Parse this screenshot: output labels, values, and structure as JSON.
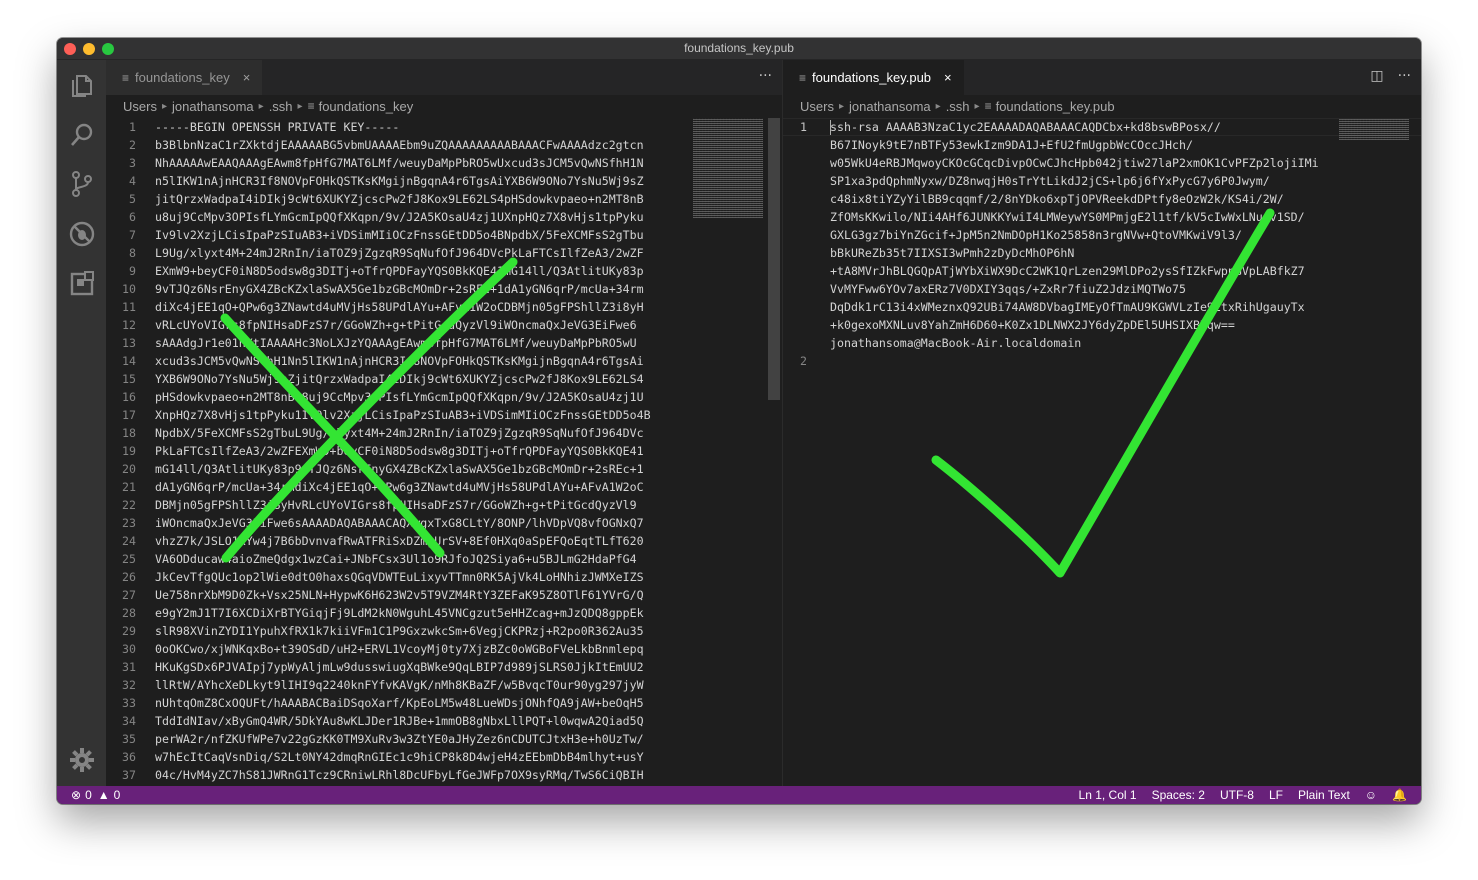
{
  "window": {
    "title": "foundations_key.pub"
  },
  "icons": {
    "explorer": "files-icon",
    "search": "search-icon",
    "scm": "source-control-icon",
    "debug": "debug-icon",
    "extensions": "extensions-icon",
    "settings": "gear-icon"
  },
  "left_editor": {
    "tab_label": "foundations_key",
    "tab_close": "×",
    "breadcrumb": [
      "Users",
      "jonathansoma",
      ".ssh",
      "foundations_key"
    ],
    "lines": [
      "-----BEGIN OPENSSH PRIVATE KEY-----",
      "b3BlbnNzaC1rZXktdjEAAAAABG5vbmUAAAAEbm9uZQAAAAAAAAABAAACFwAAAAdzc2gtcn",
      "NhAAAAAwEAAQAAAgEAwm8fpHfG7MAT6LMf/weuyDaMpPbRO5wUxcud3sJCM5vQwNSfhH1N",
      "n5lIKW1nAjnHCR3If8NOVpFOHkQSTKsKMgijnBgqnA4r6TgsAiYXB6W9ONo7YsNu5Wj9sZ",
      "jitQrzxWadpaI4iDIkj9cWt6XUKYZjcscPw2fJ8Kox9LE62LS4pHSdowkvpaeo+n2MT8nB",
      "u8uj9CcMpv3OPIsfLYmGcmIpQQfXKqpn/9v/J2A5KOsaU4zj1UXnpHQz7X8vHjs1tpPyku",
      "Iv9lv2XzjLCisIpaPzSIuAB3+iVDSimMIiOCzFnssGEtDD5o4BNpdbX/5FeXCMFsS2gTbu",
      "L9Ug/xlyxt4M+24mJ2RnIn/iaTOZ9jZgzqR9SqNufOfJ964DVcPkLaFTCsIlfZeA3/2wZF",
      "EXmW9+beyCF0iN8D5odsw8g3DITj+oTfrQPDFayYQS0BkKQE41mG14ll/Q3AtlitUKy83p",
      "9vTJQz6NsrEnyGX4ZBcKZxlaSwAX5Ge1bzGBcMOmDr+2sREc+1dA1yGN6qrP/mcUa+34rm",
      "diXc4jEE1qO+QPw6g3ZNawtd4uMVjHs58UPdlAYu+AFvA1W2oCDBMjn05gFPShllZ3i8yH",
      "vRLcUYoVIGrs8fpNIHsaDFzS7r/GGoWZh+g+tPitGcdQyzVl9iWOncmaQxJeVG3EiFwe6",
      "sAAAdgJr1e01hXtIAAAAHc3NoLXJzYQAAAgEAwm8fpHfG7MAT6LMf/weuyDaMpPbRO5wU",
      "xcud3sJCM5vQwNSfhH1Nn5lIKW1nAjnHCR3If8NOVpFOHkQSTKsKMgijnBgqnA4r6TgsAi",
      "YXB6W9ONo7YsNu5Wj9sZjitQrzxWadpaI4iDIkj9cWt6XUKYZjcscPw2fJ8Kox9LE62LS4",
      "pHSdowkvpaeo+n2MT8nBu8uj9CcMpv3OPIsfLYmGcmIpQQfXKqpn/9v/J2A5KOsaU4zj1U",
      "XnpHQz7X8vHjs1tpPyku1Iv9lv2XzjLCisIpaPzSIuAB3+iVDSimMIiOCzFnssGEtDD5o4B",
      "NpdbX/5FeXCMFsS2gTbuL9Ug/xlyxt4M+24mJ2RnIn/iaTOZ9jZgzqR9SqNufOfJ964DVc",
      "PkLaFTCsIlfZeA3/2wZFEXmW9+beyCF0iN8D5odsw8g3DITj+oTfrQPDFayYQS0BkKQE41",
      "mG14ll/Q3AtlitUKy83p9vTJQz6NsrEnyGX4ZBcKZxlaSwAX5Ge1bzGBcMOmDr+2sREc+1",
      "dA1yGN6qrP/mcUa+34rmdiXc4jEE1qO+QPw6g3ZNawtd4uMVjHs58UPdlAYu+AFvA1W2oC",
      "DBMjn05gFPShllZ3i8yHvRLcUYoVIGrs8fpNIHsaDFzS7r/GGoWZh+g+tPitGcdQyzVl9",
      "iWOncmaQxJeVG3EiFwe6sAAAADAQABAAACAQXwgxTxG8CLtY/8ONP/lhVDpVQ8vfOGNxQ7",
      "vhzZ7k/JSLO1kYw4j7B6bDvnvafRwATFRiSxDZmgUrSV+8Ef0HXq0aSpEFQoEqtTLfT620",
      "VA6ODducaw4aioZmeQdgx1wzCai+JNbFCsx3Ul1o9RJfoJQ2Siya6+u5BJLmG2HdaPfG4",
      "JkCevTfgQUc1op2lWie0dtO0haxsQGqVDWTEuLixyvTTmn0RK5AjVk4LoHNhizJWMXeIZS",
      "Ue758nrXbM9D0Zk+Vsx25NLN+HypwK6H623W2v5T9VZM4RtY3ZEFaK95Z8OTlF61YVrG/Q",
      "e9gY2mJ1T7I6XCDiXrBTYGiqjFj9LdM2kN0WguhL45VNCgzut5eHHZcag+mJzQDQ8gppEk",
      "slR98XVinZYDI1YpuhXfRX1k7kiiVFm1C1P9GxzwkcSm+6VegjCKPRzj+R2po0R362Au35",
      "0oOKCwo/xjWNKqxBo+t39OSdD/uH2+ERVL1VcoyMj0ty7XjzBZc0oWGBoFVeLkbBnmlepq",
      "HKuKgSDx6PJVAIpj7ypWyAljmLw9dusswiugXqBWke9QqLBIP7d989jSLRS0JjkItEmUU2",
      "llRtW/AYhcXeDLkyt9lIHI9q2240knFYfvKAVgK/nMh8KBaZF/w5BvqcT0ur90yg297jyW",
      "nUhtqOmZ8CxOQUFt/hAAABACBaiDSqoXarf/KpEoLM5w48LueWDsjONhfQA9jAW+beOqH5",
      "TddIdNIav/xByGmQ4WR/5DkYAu8wKLJDer1RJBe+1mmOB8gNbxLllPQT+l0wqwA2Qiad5Q",
      "perWA2r/nfZKUfWPe7v22gGzKK0TM9XuRv3w3ZtYE0aJHyZez6nCDUTCJtxH3e+h0UzTw/",
      "w7hEcItCaqVsnDiq/S2Lt0NY42dmqRnGIEc1c9hiCP8k8D4wjeH4zEEbmDbB4mlhyt+usY",
      "04c/HvM4yZC7hS81JWRnG1Tcz9CRniwLRhl8DcUFbyLfGeJWFp7OX9syRMq/TwS6CiQBIH"
    ]
  },
  "right_editor": {
    "tab_label": "foundations_key.pub",
    "tab_close": "×",
    "breadcrumb": [
      "Users",
      "jonathansoma",
      ".ssh",
      "foundations_key.pub"
    ],
    "line_numbers": [
      "1",
      "2"
    ],
    "line1_wrapped": [
      "ssh-rsa AAAAB3NzaC1yc2EAAAADAQABAAACAQDCbx+kd8bswBPosx//",
      "B67INoyk9tE7nBTFy53ewkIzm9DA1J+EfU2fmUgpbWcCOccJHch/",
      "w05WkU4eRBJMqwoyCKOcGCqcDivpOCwCJhcHpb042jtiw27laP2xmOK1CvPFZp2lojiIMi",
      "SP1xa3pdQphmNyxw/DZ8nwqjH0sTrYtLikdJ2jCS+lp6j6fYxPycG7y6P0Jwym/",
      "c48ix8tiYZyYilBB9cqqmf/2/8nYDko6xpTjOPVReekdDPtfy8eOzW2k/KS4i/2W/",
      "ZfOMsKKwilo/NIi4AHf6JUNKKYwiI4LMWeywYS0MPmjgE2l1tf/kV5cIwWxLNu4v1SD/",
      "GXLG3gz7biYnZGcif+JpM5n2NmDOpH1Ko25858n3rgNVw+QtoVMKwiV9l3/",
      "bBkUReZb35t7IIXSI3wPmh2zDyDcMhOP6hN",
      "+tA8MVrJhBLQGQpATjWYbXiWX9DcC2WK1QrLzen29MlDPo2ysSfIZkFwpnGVpLABfkZ7",
      "VvMYFww6YOv7axERz7V0DXIY3qqs/+ZxRr7fiuZ2JdziMQTWo75",
      "DqDdk1rC13i4xWMeznxQ92UBi74AW8DVbagIMEyOfTmAU9KGWVLzIe9EtxRihUgauyTx",
      "+k0gexoMXNLuv8YahZmH6D60+K0Zx1DLNWX2JY6dyZpDEl5UHSIXB7qw==",
      "jonathansoma@MacBook-Air.localdomain"
    ]
  },
  "status": {
    "errors": "0",
    "warnings": "0",
    "position": "Ln 1, Col 1",
    "spaces": "Spaces: 2",
    "encoding": "UTF-8",
    "eol": "LF",
    "language": "Plain Text"
  },
  "annotations": {
    "cross_color": "#33e533",
    "check_color": "#33e533"
  }
}
